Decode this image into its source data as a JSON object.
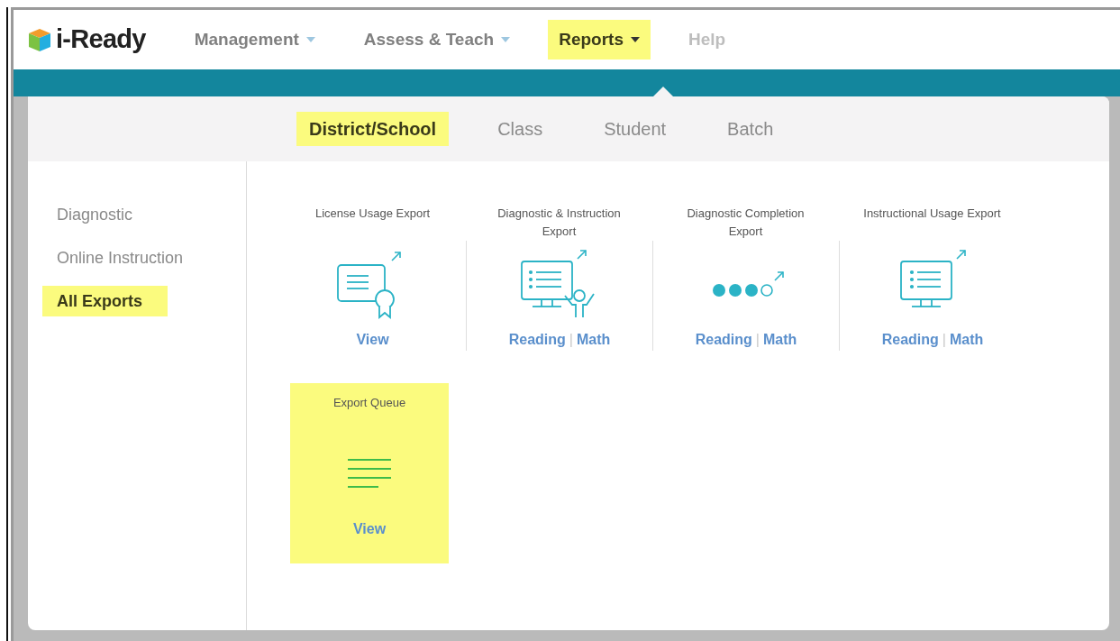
{
  "logo": {
    "text": "i-Ready"
  },
  "nav": [
    {
      "label": "Management",
      "has_menu": true,
      "selected": false,
      "disabled": false
    },
    {
      "label": "Assess & Teach",
      "has_menu": true,
      "selected": false,
      "disabled": false
    },
    {
      "label": "Reports",
      "has_menu": true,
      "selected": true,
      "disabled": false
    },
    {
      "label": "Help",
      "has_menu": false,
      "selected": false,
      "disabled": true
    }
  ],
  "tabs": [
    {
      "label": "District/School",
      "selected": true
    },
    {
      "label": "Class",
      "selected": false
    },
    {
      "label": "Student",
      "selected": false
    },
    {
      "label": "Batch",
      "selected": false
    }
  ],
  "sidebar": {
    "items": [
      {
        "label": "Diagnostic",
        "selected": false
      },
      {
        "label": "Online Instruction",
        "selected": false
      },
      {
        "label": "All Exports",
        "selected": true
      }
    ]
  },
  "exports": [
    {
      "title": "License Usage Export",
      "kind": "certificate",
      "links": [
        "View"
      ],
      "highlighted": false
    },
    {
      "title": "Diagnostic & Instruction Export",
      "kind": "student",
      "links": [
        "Reading",
        "Math"
      ],
      "separator": "|",
      "highlighted": false
    },
    {
      "title": "Diagnostic Completion Export",
      "kind": "progress",
      "links": [
        "Reading",
        "Math"
      ],
      "separator": "|",
      "highlighted": false
    },
    {
      "title": "Instructional Usage Export",
      "kind": "monitor",
      "links": [
        "Reading",
        "Math"
      ],
      "separator": "|",
      "highlighted": false
    },
    {
      "title": "Export Queue",
      "kind": "queue",
      "links": [
        "View"
      ],
      "highlighted": true
    }
  ]
}
